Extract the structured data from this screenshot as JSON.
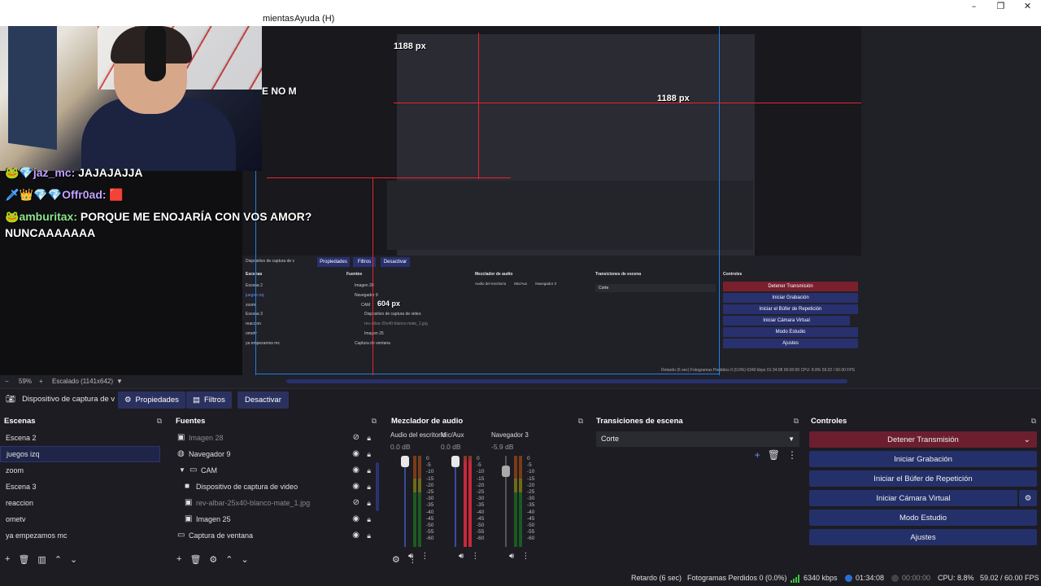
{
  "window": {
    "controls": [
      "–",
      "❐",
      "✕"
    ]
  },
  "menu": {
    "items": [
      "mientas",
      "Ayuda (H)"
    ]
  },
  "preview": {
    "chat": [
      {
        "badges": "🐸💎",
        "name": "jaz_mc:",
        "msg": " JAJAJAJJA"
      },
      {
        "badges": "🗡👑💎💎",
        "name": "Offr0ad:",
        "msg": " 🟥"
      },
      {
        "badges": "🐸",
        "name": "amburitax:",
        "msg": " PORQUE ME ENOJARÍA CON VOS AMOR?"
      },
      {
        "badges": "",
        "name": "",
        "msg": "NUNCAAAAAAA"
      }
    ],
    "nested_labels": {
      "no_m": "E NO M",
      "px_1188": "1188 px",
      "px_604": "604 px",
      "px_1188b": "1188 px"
    },
    "nested_mini": {
      "context_source": "Dispositivo de captura de v",
      "props": "Propiedades",
      "filters": "Filtros",
      "deactivate": "Desactivar",
      "scenes_title": "Escenas",
      "sources_title": "Fuentes",
      "audio_title": "Mezclador de audio",
      "trans_title": "Transiciones de escena",
      "controls_title": "Controles",
      "scenes": [
        "Escena 2",
        "juegos izq",
        "zoom",
        "Escena 3",
        "reaccion",
        "ometv",
        "ya empezamos mc"
      ],
      "sources": [
        "Imagen 28",
        "Navegador 9",
        "CAM",
        "Dispositivo de captura de video",
        "rev-albar-25x40-blanco-mate_1.jpg",
        "Imagen 25",
        "Captura de ventana"
      ],
      "controls": [
        "Detener Transmisión",
        "Iniciar Grabación",
        "Iniciar el Búfer de Repetición",
        "Iniciar Cámara Virtual",
        "Modo Estudio",
        "Ajustes"
      ],
      "transition": "Corte",
      "audio_channels": [
        "Audio del escritorio",
        "Mic/Aux",
        "Navegador 3"
      ],
      "status": "Retardo (6 sec)   Fotogramas Perdidos 0 (0.0%)   6340 kbps   01:34:08   00:00:00   CPU: 8.8%   59.02 / 60.00 FPS"
    }
  },
  "preview_footer": {
    "zoom_minus": "−",
    "zoom": "59%",
    "zoom_plus": "+",
    "scale": "Escalado (1141x642)",
    "scale_caret": "▼"
  },
  "context_bar": {
    "source": "Dispositivo de captura de v",
    "properties": "Propiedades",
    "filters": "Filtros",
    "deactivate": "Desactivar"
  },
  "scenes": {
    "title": "Escenas",
    "items": [
      "Escena 2",
      "juegos izq",
      "zoom",
      "Escena 3",
      "reaccion",
      "ometv",
      "ya empezamos mc"
    ],
    "selected_index": 1
  },
  "sources": {
    "title": "Fuentes",
    "items": [
      {
        "label": "Imagen 28",
        "icon": "image-icon",
        "visible": false,
        "locked": true
      },
      {
        "label": "Navegador 9",
        "icon": "globe-icon",
        "visible": true,
        "locked": true
      },
      {
        "label": "CAM",
        "icon": "folder-icon",
        "visible": true,
        "locked": true
      },
      {
        "label": "Dispositivo de captura de video",
        "icon": "camera-icon",
        "visible": true,
        "locked": true
      },
      {
        "label": "rev-albar-25x40-blanco-mate_1.jpg",
        "icon": "image-icon",
        "visible": false,
        "locked": true
      },
      {
        "label": "Imagen 25",
        "icon": "image-icon",
        "visible": true,
        "locked": true
      },
      {
        "label": "Captura de ventana",
        "icon": "window-icon",
        "visible": true,
        "locked": true
      }
    ]
  },
  "audio": {
    "title": "Mezclador de audio",
    "channels": [
      {
        "name": "Audio del escritorio",
        "db": "0.0 dB",
        "fader": 1.0
      },
      {
        "name": "Mic/Aux",
        "db": "0.0 dB",
        "fader": 1.0
      },
      {
        "name": "Navegador 3",
        "db": "-5.9 dB",
        "fader": 0.88
      }
    ],
    "scale": [
      "0",
      "-5",
      "-10",
      "-15",
      "-20",
      "-25",
      "-30",
      "-35",
      "-40",
      "-45",
      "-50",
      "-55",
      "-60"
    ]
  },
  "transitions": {
    "title": "Transiciones de escena",
    "selected": "Corte"
  },
  "controls": {
    "title": "Controles",
    "stop_stream": "Detener Transmisión",
    "start_recording": "Iniciar Grabación",
    "replay_buffer": "Iniciar el Búfer de Repetición",
    "virtual_camera": "Iniciar Cámara Virtual",
    "studio_mode": "Modo Estudio",
    "settings": "Ajustes"
  },
  "status": {
    "delay": "Retardo (6 sec)",
    "dropped": "Fotogramas Perdidos 0 (0.0%)",
    "bitrate": "6340 kbps",
    "stream_time": "01:34:08",
    "rec_time": "00:00:00",
    "cpu": "CPU: 8.8%",
    "fps": "59.02 / 60.00 FPS"
  },
  "colors": {
    "accent": "#24306a",
    "stop": "#6b1f2e",
    "guide_blue": "#1e7fe6",
    "guide_red": "#e8242d"
  }
}
